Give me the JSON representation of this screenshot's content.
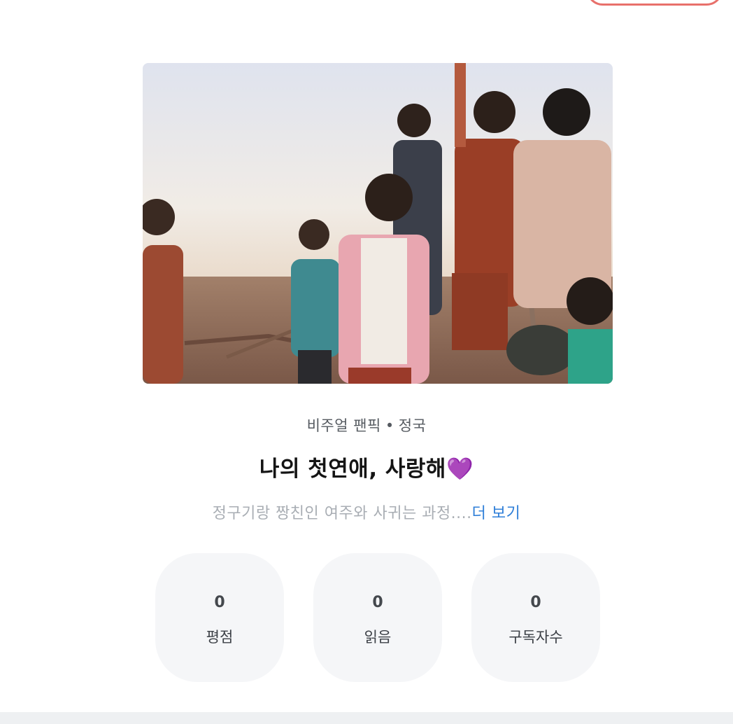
{
  "header": {
    "top_button_label": ""
  },
  "cover": {
    "alt_icon": "cover-photo"
  },
  "story": {
    "category": "비주얼 팬픽",
    "separator": "•",
    "character": "정국",
    "title": "나의 첫연애, 사랑해",
    "title_emoji": "💜",
    "description": "정구기랑 짱친인 여주와 사귀는 과정....",
    "more_link": "더 보기"
  },
  "stats": [
    {
      "value": "0",
      "label": "평점"
    },
    {
      "value": "0",
      "label": "읽음"
    },
    {
      "value": "0",
      "label": "구독자수"
    }
  ],
  "colors": {
    "accent_link": "#2f7fd8",
    "pill_border": "#e8706b",
    "card_bg": "#f5f6f8"
  }
}
